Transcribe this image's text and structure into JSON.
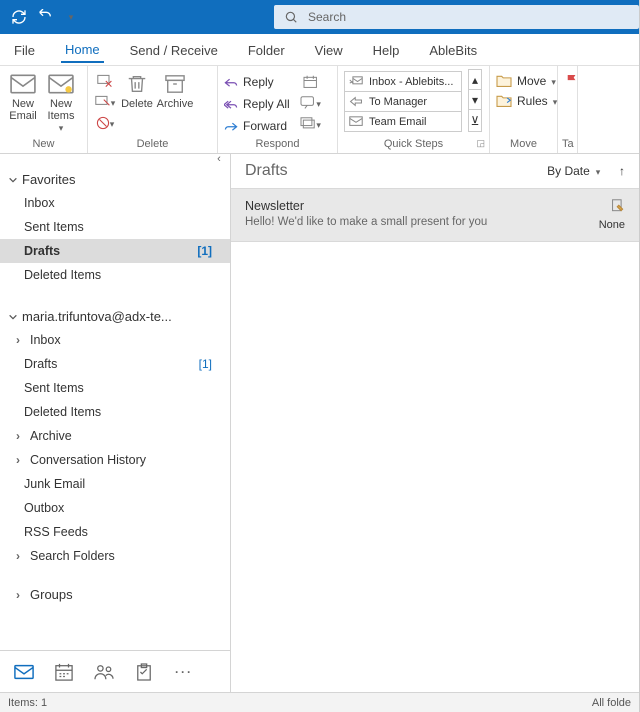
{
  "search": {
    "placeholder": "Search"
  },
  "tabs": [
    "File",
    "Home",
    "Send / Receive",
    "Folder",
    "View",
    "Help",
    "AbleBits"
  ],
  "activeTab": "Home",
  "ribbon": {
    "new": {
      "newEmail": "New\nEmail",
      "newItems": "New\nItems",
      "label": "New"
    },
    "delete": {
      "delete": "Delete",
      "archive": "Archive",
      "label": "Delete"
    },
    "respond": {
      "reply": "Reply",
      "replyAll": "Reply All",
      "forward": "Forward",
      "label": "Respond"
    },
    "qs": {
      "item1": "Inbox - Ablebits...",
      "item2": "To Manager",
      "item3": "Team Email",
      "label": "Quick Steps"
    },
    "move": {
      "move": "Move",
      "rules": "Rules",
      "label": "Move"
    },
    "tags": {
      "label": "Ta"
    }
  },
  "nav": {
    "favorites": {
      "title": "Favorites"
    },
    "fav_items": [
      {
        "label": "Inbox"
      },
      {
        "label": "Sent Items"
      },
      {
        "label": "Drafts",
        "count": "[1]",
        "active": true
      },
      {
        "label": "Deleted Items"
      }
    ],
    "account": "maria.trifuntova@adx-te...",
    "acct_items": [
      {
        "label": "Inbox",
        "exp": true
      },
      {
        "label": "Drafts",
        "count": "[1]"
      },
      {
        "label": "Sent Items"
      },
      {
        "label": "Deleted Items"
      },
      {
        "label": "Archive",
        "exp": true
      },
      {
        "label": "Conversation History",
        "exp": true
      },
      {
        "label": "Junk Email"
      },
      {
        "label": "Outbox"
      },
      {
        "label": "RSS Feeds"
      },
      {
        "label": "Search Folders",
        "exp": true
      }
    ],
    "groups": "Groups"
  },
  "list": {
    "folder": "Drafts",
    "sort": "By Date",
    "msg": {
      "subject": "Newsletter",
      "preview": "Hello!  We'd like to make a small present for you",
      "date": "None"
    }
  },
  "status": {
    "left": "Items: 1",
    "right": "All folde"
  }
}
